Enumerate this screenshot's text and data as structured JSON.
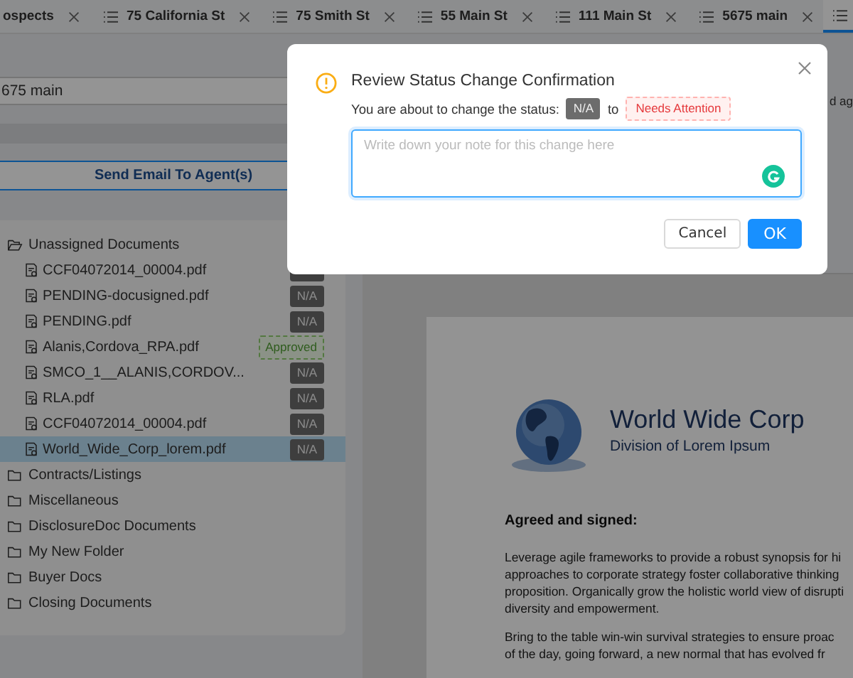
{
  "tabs": [
    {
      "label": "ospects",
      "icon": false,
      "selected": false
    },
    {
      "label": "75 California St",
      "icon": true,
      "selected": false
    },
    {
      "label": "75 Smith St",
      "icon": true,
      "selected": false
    },
    {
      "label": "55 Main St",
      "icon": true,
      "selected": false
    },
    {
      "label": "111 Main St",
      "icon": true,
      "selected": false
    },
    {
      "label": "5675 main",
      "icon": true,
      "selected": false
    },
    {
      "icon": true,
      "selected": true
    }
  ],
  "property_field": {
    "value": "675 main"
  },
  "side_text": "d ag",
  "send_email_button": "Send Email To Agent(s)",
  "folders": [
    {
      "name": "Unassigned Documents",
      "expanded": true,
      "children": [
        {
          "name": "CCF04072014_00004.pdf",
          "status": {
            "kind": "na"
          },
          "selected": false
        },
        {
          "name": "PENDING-docusigned.pdf",
          "status": {
            "text": "N/A",
            "kind": "na"
          },
          "selected": false
        },
        {
          "name": "PENDING.pdf",
          "status": {
            "text": "N/A",
            "kind": "na"
          },
          "selected": false
        },
        {
          "name": "Alanis,Cordova_RPA.pdf",
          "status": {
            "text": "Approved",
            "kind": "approved"
          },
          "selected": false
        },
        {
          "name": "SMCO_1__ALANIS,CORDOV...",
          "status": {
            "text": "N/A",
            "kind": "na"
          },
          "selected": false
        },
        {
          "name": "RLA.pdf",
          "status": {
            "text": "N/A",
            "kind": "na"
          },
          "selected": false
        },
        {
          "name": "CCF04072014_00004.pdf",
          "status": {
            "text": "N/A",
            "kind": "na"
          },
          "selected": false
        },
        {
          "name": "World_Wide_Corp_lorem.pdf",
          "status": {
            "text": "N/A",
            "kind": "na"
          },
          "selected": true
        }
      ]
    },
    {
      "name": "Contracts/Listings",
      "expanded": false
    },
    {
      "name": "Miscellaneous",
      "expanded": false
    },
    {
      "name": "DisclosureDoc Documents",
      "expanded": false
    },
    {
      "name": "My New Folder",
      "expanded": false
    },
    {
      "name": "Buyer Docs",
      "expanded": false
    },
    {
      "name": "Closing Documents",
      "expanded": false
    }
  ],
  "document": {
    "company": "World Wide Corp",
    "division": "Division of Lorem Ipsum",
    "heading": "Agreed and signed:",
    "paragraphs": [
      [
        "Leverage agile frameworks to provide a robust synopsis for hi",
        "approaches to corporate strategy foster collaborative thinking",
        "proposition. Organically grow the holistic world view of disrupti",
        "diversity and empowerment."
      ],
      [
        "Bring to the table win-win survival strategies to ensure proac",
        "of the day, going forward, a new normal that has evolved fr"
      ]
    ]
  },
  "dialog": {
    "title": "Review Status Change Confirmation",
    "message": "You are about to change the status:",
    "from_status": {
      "text": "N/A",
      "kind": "na"
    },
    "connector": "to",
    "to_status": {
      "text": "Needs Attention",
      "kind": "attention"
    },
    "note": {
      "placeholder": "Write down your note for this change here"
    },
    "buttons": [
      {
        "label": "Cancel",
        "kind": "default"
      },
      {
        "label": "OK",
        "kind": "primary"
      }
    ]
  }
}
